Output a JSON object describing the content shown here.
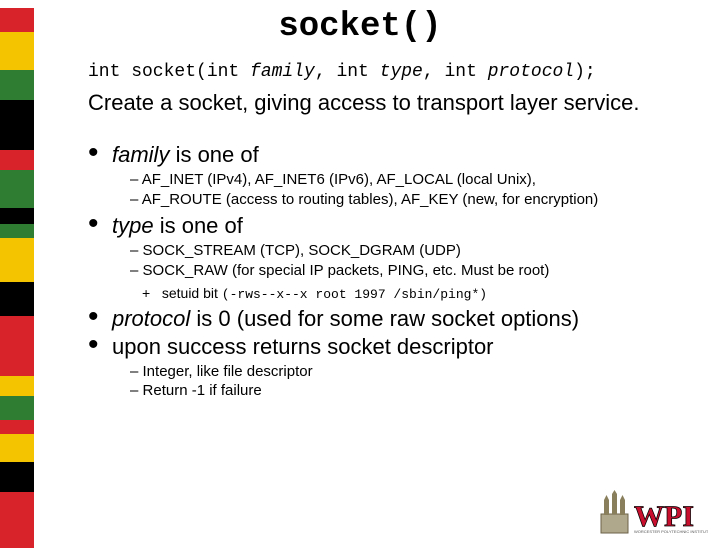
{
  "title": "socket()",
  "signature": {
    "pre1": "int socket(int ",
    "p1": "family",
    "mid1": ", int ",
    "p2": "type",
    "mid2": ", int ",
    "p3": "protocol",
    "post": ");"
  },
  "description": "Create a socket, giving access to transport layer service.",
  "bullets": [
    {
      "param": "family",
      "tail": " is one of",
      "subs": [
        "AF_INET (IPv4), AF_INET6 (IPv6), AF_LOCAL (local Unix),",
        "AF_ROUTE (access to routing tables), AF_KEY (new, for encryption)"
      ]
    },
    {
      "param": "type",
      "tail": " is one of",
      "subs": [
        "SOCK_STREAM (TCP), SOCK_DGRAM (UDP)",
        "SOCK_RAW (for special IP packets, PING, etc.  Must be root)"
      ],
      "plus": {
        "lead": "setuid bit ",
        "mono": "(-rws--x--x root 1997 /sbin/ping*)"
      }
    },
    {
      "param": "protocol",
      "tail": " is 0 (used for some raw socket options)"
    },
    {
      "plain": "upon success returns socket descriptor",
      "subs": [
        "Integer, like file descriptor",
        "Return -1 if failure"
      ]
    }
  ],
  "sidestrip_colors": [
    {
      "c": "#d8232a",
      "h": 24
    },
    {
      "c": "#f5c400",
      "h": 38
    },
    {
      "c": "#2e7d32",
      "h": 30
    },
    {
      "c": "#000000",
      "h": 50
    },
    {
      "c": "#d8232a",
      "h": 20
    },
    {
      "c": "#2e7d32",
      "h": 38
    },
    {
      "c": "#000000",
      "h": 16
    },
    {
      "c": "#2e7d32",
      "h": 14
    },
    {
      "c": "#f5c400",
      "h": 44
    },
    {
      "c": "#000000",
      "h": 34
    },
    {
      "c": "#d8232a",
      "h": 60
    },
    {
      "c": "#f5c400",
      "h": 20
    },
    {
      "c": "#2e7d32",
      "h": 24
    },
    {
      "c": "#d8232a",
      "h": 14
    },
    {
      "c": "#f5c400",
      "h": 28
    },
    {
      "c": "#000000",
      "h": 30
    },
    {
      "c": "#d8232a",
      "h": 56
    }
  ],
  "logo": {
    "text": "WPI"
  }
}
